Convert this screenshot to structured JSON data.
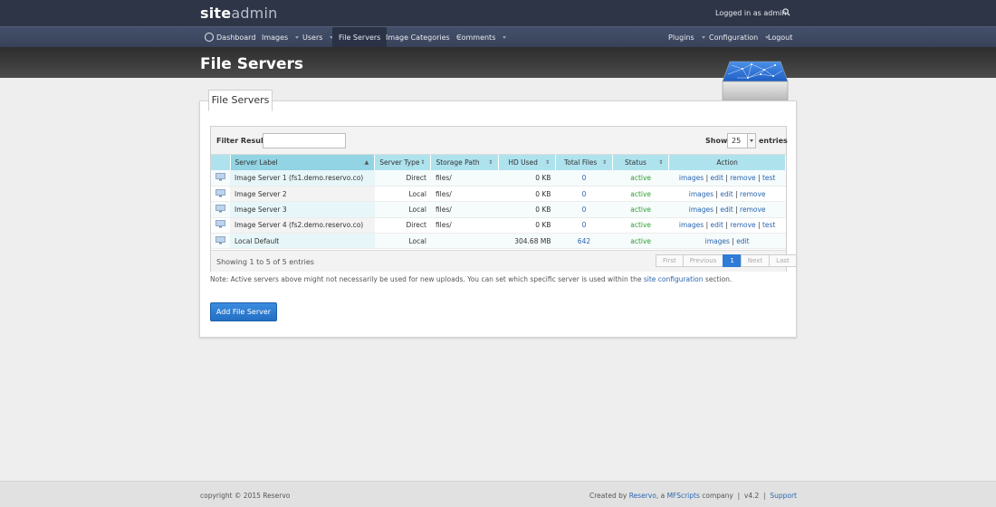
{
  "header": {
    "logo_a": "site",
    "logo_b": "admin",
    "logged_in": "Logged in as admin"
  },
  "nav": {
    "dashboard": "Dashboard",
    "images": "Images",
    "users": "Users",
    "file_servers": "File Servers",
    "image_categories": "Image Categories",
    "comments": "Comments",
    "plugins": "Plugins",
    "configuration": "Configuration",
    "logout": "Logout"
  },
  "page": {
    "title": "File Servers",
    "tab": "File Servers"
  },
  "filters": {
    "filter_label": "Filter Results:",
    "filter_value": "",
    "show_label": "Show",
    "show_value": "25",
    "entries_label": "entries"
  },
  "table": {
    "columns": [
      "Server Label",
      "Server Type",
      "Storage Path",
      "HD Used",
      "Total Files",
      "Status",
      "Action"
    ],
    "rows": [
      {
        "label": "Image Server 1 (fs1.demo.reservo.co)",
        "type": "Direct",
        "path": "files/",
        "hd": "0 KB",
        "files": "0",
        "status": "active",
        "actions": [
          "images",
          "edit",
          "remove",
          "test"
        ]
      },
      {
        "label": "Image Server 2",
        "type": "Local",
        "path": "files/",
        "hd": "0 KB",
        "files": "0",
        "status": "active",
        "actions": [
          "images",
          "edit",
          "remove"
        ]
      },
      {
        "label": "Image Server 3",
        "type": "Local",
        "path": "files/",
        "hd": "0 KB",
        "files": "0",
        "status": "active",
        "actions": [
          "images",
          "edit",
          "remove"
        ]
      },
      {
        "label": "Image Server 4 (fs2.demo.reservo.co)",
        "type": "Direct",
        "path": "files/",
        "hd": "0 KB",
        "files": "0",
        "status": "active",
        "actions": [
          "images",
          "edit",
          "remove",
          "test"
        ]
      },
      {
        "label": "Local Default",
        "type": "Local",
        "path": "",
        "hd": "304.68 MB",
        "files": "642",
        "status": "active",
        "actions": [
          "images",
          "edit"
        ]
      }
    ],
    "showing": "Showing 1 to 5 of 5 entries",
    "pager": [
      "First",
      "Previous",
      "1",
      "Next",
      "Last"
    ]
  },
  "note": {
    "before": "Note: Active servers above might not necessarily be used for new uploads. You can set which specific server is used within the ",
    "link": "site configuration",
    "after": " section."
  },
  "add_button": "Add File Server",
  "footer": {
    "copyright": "copyright © 2015 Reservo",
    "created_by": "Created by ",
    "reservo": "Reservo",
    "a_company": ", a ",
    "mfscripts": "MFScripts",
    "company_version": " company  |  v4.2  |  ",
    "support": "Support"
  },
  "colors": {
    "topbar": "#2e3547",
    "accent_blue": "#2f7bd6",
    "table_header": "#aee3ee",
    "status_active": "#2e9e2e"
  }
}
